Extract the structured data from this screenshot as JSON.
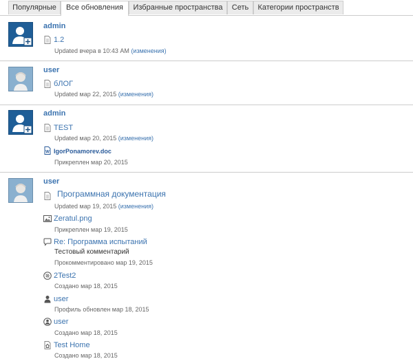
{
  "tabs": [
    {
      "label": "Популярные"
    },
    {
      "label": "Все обновления"
    },
    {
      "label": "Избранные пространства"
    },
    {
      "label": "Сеть"
    },
    {
      "label": "Категории пространств"
    }
  ],
  "active_tab": "Все обновления",
  "groups": [
    {
      "user": "admin",
      "avatar": "admin-avatar-icon",
      "items": [
        {
          "icon": "page-icon",
          "title": "1.2",
          "meta_prefix": "Updated вчера в 10:43 AM",
          "meta_link": "(изменения)"
        }
      ]
    },
    {
      "user": "user",
      "avatar": "user-avatar-icon",
      "items": [
        {
          "icon": "page-icon",
          "title": "бЛОГ",
          "meta_prefix": "Updated мар 22, 2015",
          "meta_link": "(изменения)"
        }
      ]
    },
    {
      "user": "admin",
      "avatar": "admin-avatar-icon",
      "items": [
        {
          "icon": "page-icon",
          "title": "TEST",
          "meta_prefix": "Updated мар 20, 2015",
          "meta_link": "(изменения)"
        },
        {
          "icon": "word-doc-icon",
          "title": "IgorPonamorev.doc",
          "meta": "Прикреплен мар 20, 2015"
        }
      ]
    },
    {
      "user": "user",
      "avatar": "user-avatar-icon",
      "items": [
        {
          "icon": "page-icon",
          "title": "Программная документация",
          "meta_prefix": "Updated мар 19, 2015",
          "meta_link": "(изменения)"
        },
        {
          "icon": "image-icon",
          "title": "Zeratul.png",
          "meta": "Прикреплен мар 19, 2015"
        },
        {
          "icon": "comment-icon",
          "title": "Re: Программа испытаний",
          "comment": "Тестовый комментарий",
          "meta": "Прокомментировано мар 19, 2015"
        },
        {
          "icon": "space-icon",
          "title": "2Test2",
          "meta": "Создано мар 18, 2015"
        },
        {
          "icon": "profile-icon",
          "title": "user",
          "meta": "Профиль обновлен мар 18, 2015"
        },
        {
          "icon": "personal-space-icon",
          "title": "user",
          "meta": "Создано мар 18, 2015"
        },
        {
          "icon": "home-page-icon",
          "title": "Test Home",
          "meta": "Создано мар 18, 2015"
        }
      ]
    }
  ]
}
